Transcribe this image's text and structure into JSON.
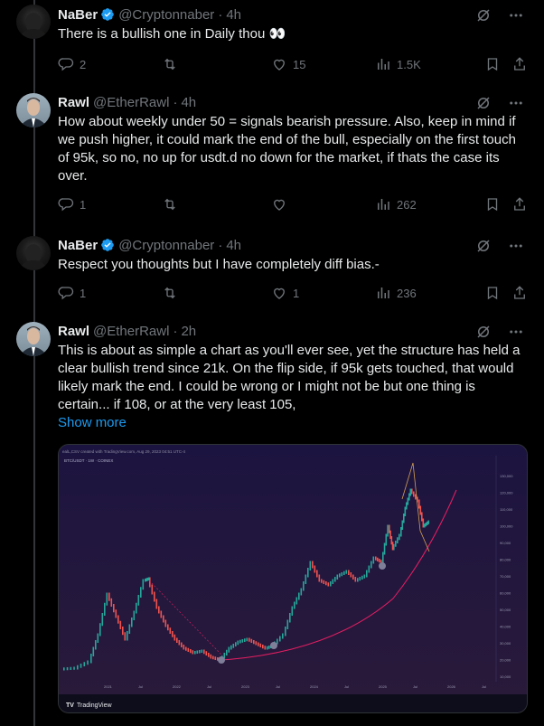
{
  "tweets": [
    {
      "name": "NaBer",
      "handle": "@Cryptonnaber",
      "time": "4h",
      "verified": true,
      "text": "There is a bullish one in Daily thou 👀",
      "replies": "2",
      "retweets": "",
      "likes": "15",
      "views": "1.5K"
    },
    {
      "name": "Rawl",
      "handle": "@EtherRawl",
      "time": "4h",
      "verified": false,
      "text": "How about weekly under 50 = signals bearish pressure. Also, keep in mind if we push higher, it could mark the end of the bull, especially on the first touch of 95k, so no, no up for usdt.d no down for the market, if thats the case its over.",
      "replies": "1",
      "retweets": "",
      "likes": "",
      "views": "262"
    },
    {
      "name": "NaBer",
      "handle": "@Cryptonnaber",
      "time": "4h",
      "verified": true,
      "text": "Respect you thoughts but I have completely diff bias.-",
      "replies": "1",
      "retweets": "",
      "likes": "1",
      "views": "236"
    },
    {
      "name": "Rawl",
      "handle": "@EtherRawl",
      "time": "2h",
      "verified": false,
      "text": "This is about as simple a chart as you'll ever see, yet the structure has held a clear bullish trend since 21k. On the flip side, if 95k gets touched, that would likely mark the end. I could be wrong or I might not be but one thing is certain... if 108, or at the very least 105,",
      "show_more": "Show more"
    }
  ],
  "media": {
    "header_text": "ealL,CSV created with TradingView.com, Aug 29, 2023 04:51 UTC-4",
    "symbol": "BTC/USDT · 1W · COINEX",
    "tradingview_label": "TradingView",
    "y_ticks": [
      "130,000",
      "120,000",
      "110,000",
      "100,000",
      "90,000",
      "80,000",
      "70,000",
      "60,000",
      "50,000",
      "40,000",
      "30,000",
      "20,000",
      "10,000"
    ],
    "x_ticks": [
      "2021",
      "Jul",
      "2022",
      "Jul",
      "2023",
      "Jul",
      "2024",
      "Jul",
      "2025",
      "Jul",
      "2026",
      "Jul"
    ],
    "up_color": "#26a69a",
    "down_color": "#ef5350",
    "curve_color": "#e91e63"
  },
  "colors": {
    "accent": "#1d9bf0",
    "muted": "#71767b",
    "text": "#e7e9ea"
  }
}
